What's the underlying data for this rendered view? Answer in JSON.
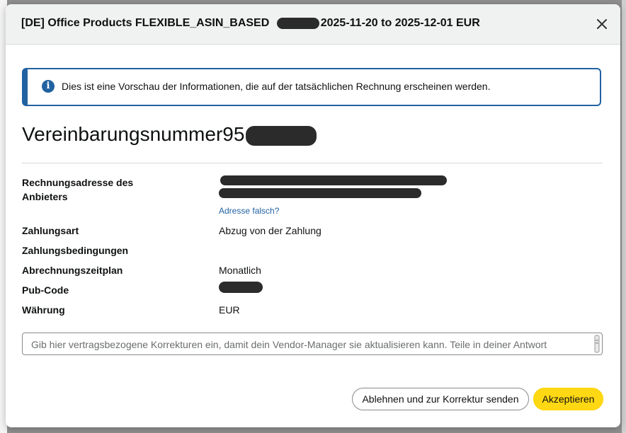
{
  "modal": {
    "title_prefix": "[DE] Office Products FLEXIBLE_ASIN_BASED",
    "title_suffix": "2025-11-20 to 2025-12-01 EUR",
    "close_icon": "close-icon"
  },
  "alert": {
    "icon": "info-icon",
    "icon_glyph": "i",
    "text": "Dies ist eine Vorschau der Informationen, die auf der tatsächlichen Rechnung erscheinen werden."
  },
  "agreement": {
    "heading_prefix": "Vereinbarungsnummer95"
  },
  "details": {
    "billing_address_label": "Rechnungsadresse des Anbieters",
    "address_fix_link": "Adresse falsch?",
    "payment_method_label": "Zahlungsart",
    "payment_method_value": "Abzug von der Zahlung",
    "payment_terms_label": "Zahlungsbedingungen",
    "payment_terms_value": "",
    "billing_schedule_label": "Abrechnungszeitplan",
    "billing_schedule_value": "Monatlich",
    "pub_code_label": "Pub-Code",
    "currency_label": "Währung",
    "currency_value": "EUR"
  },
  "corrections": {
    "placeholder": "Gib hier vertragsbezogene Korrekturen ein, damit dein Vendor-Manager sie aktualisieren kann. Teile in deiner Antwort"
  },
  "footer": {
    "reject_label": "Ablehnen und zur Korrektur senden",
    "accept_label": "Akzeptieren"
  },
  "colors": {
    "accent_blue": "#2162a1",
    "primary_button": "#ffd814",
    "header_bg": "#f0f2f2"
  }
}
